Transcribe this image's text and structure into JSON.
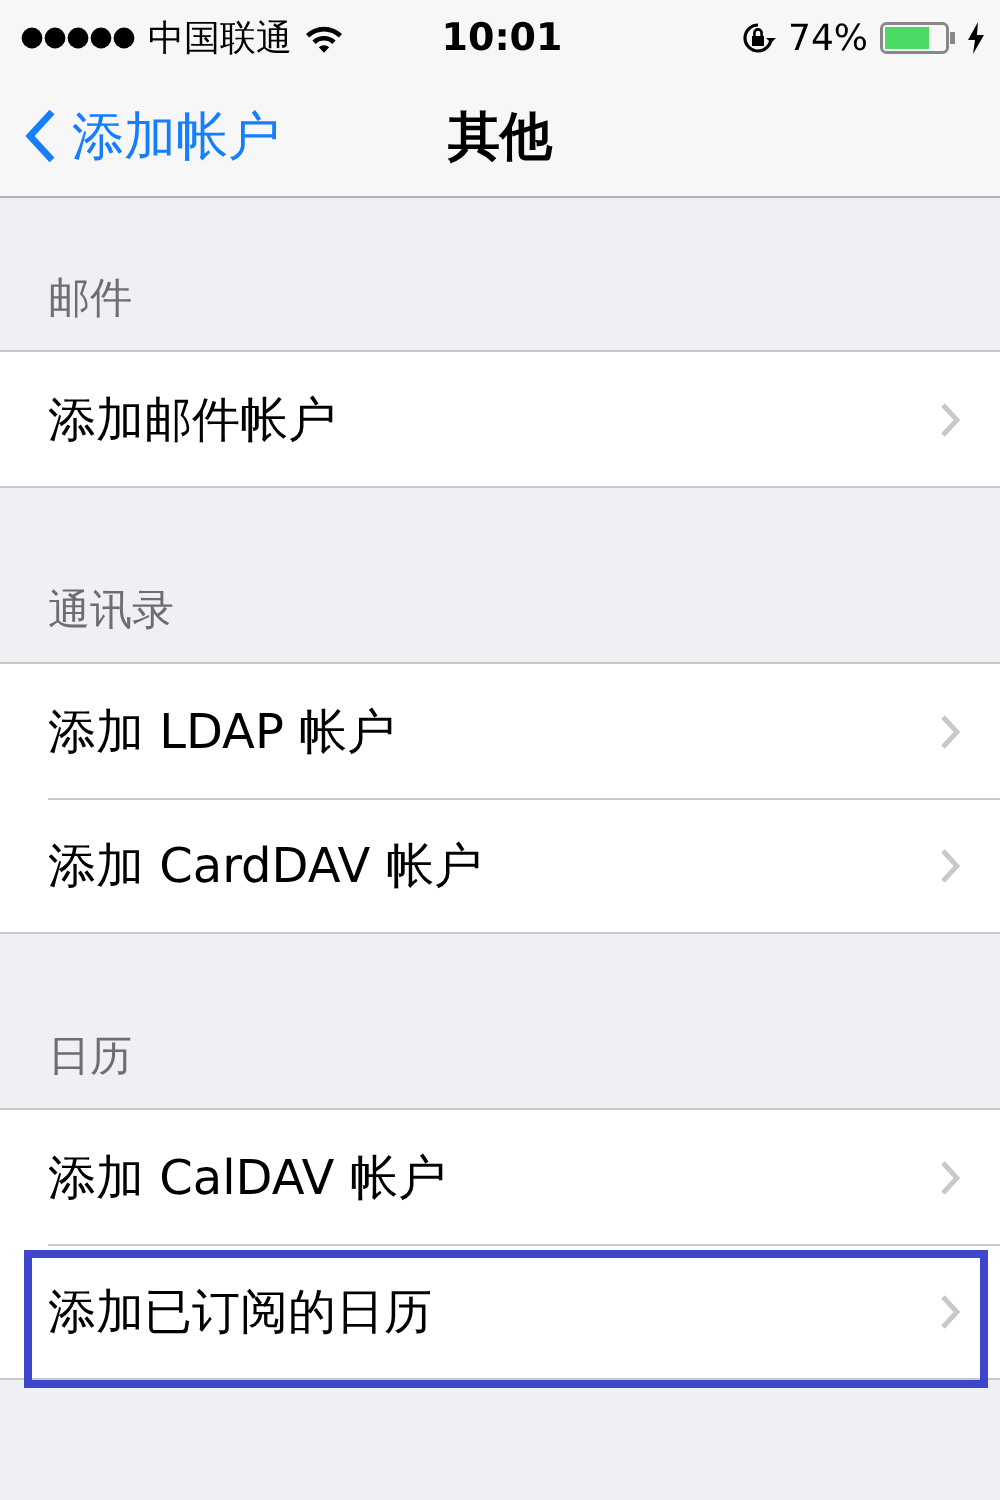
{
  "status_bar": {
    "carrier": "中国联通",
    "time": "10:01",
    "battery": "74%"
  },
  "nav_bar": {
    "back": "添加帐户",
    "title": "其他"
  },
  "sections": [
    {
      "header": "邮件",
      "rows": [
        {
          "label": "添加邮件帐户",
          "highlighted": false
        }
      ]
    },
    {
      "header": "通讯录",
      "rows": [
        {
          "label": "添加 LDAP 帐户",
          "highlighted": false
        },
        {
          "label": "添加 CardDAV 帐户",
          "highlighted": false
        }
      ]
    },
    {
      "header": "日历",
      "rows": [
        {
          "label": "添加 CalDAV 帐户",
          "highlighted": false
        },
        {
          "label": "添加已订阅的日历",
          "highlighted": true
        }
      ]
    }
  ]
}
